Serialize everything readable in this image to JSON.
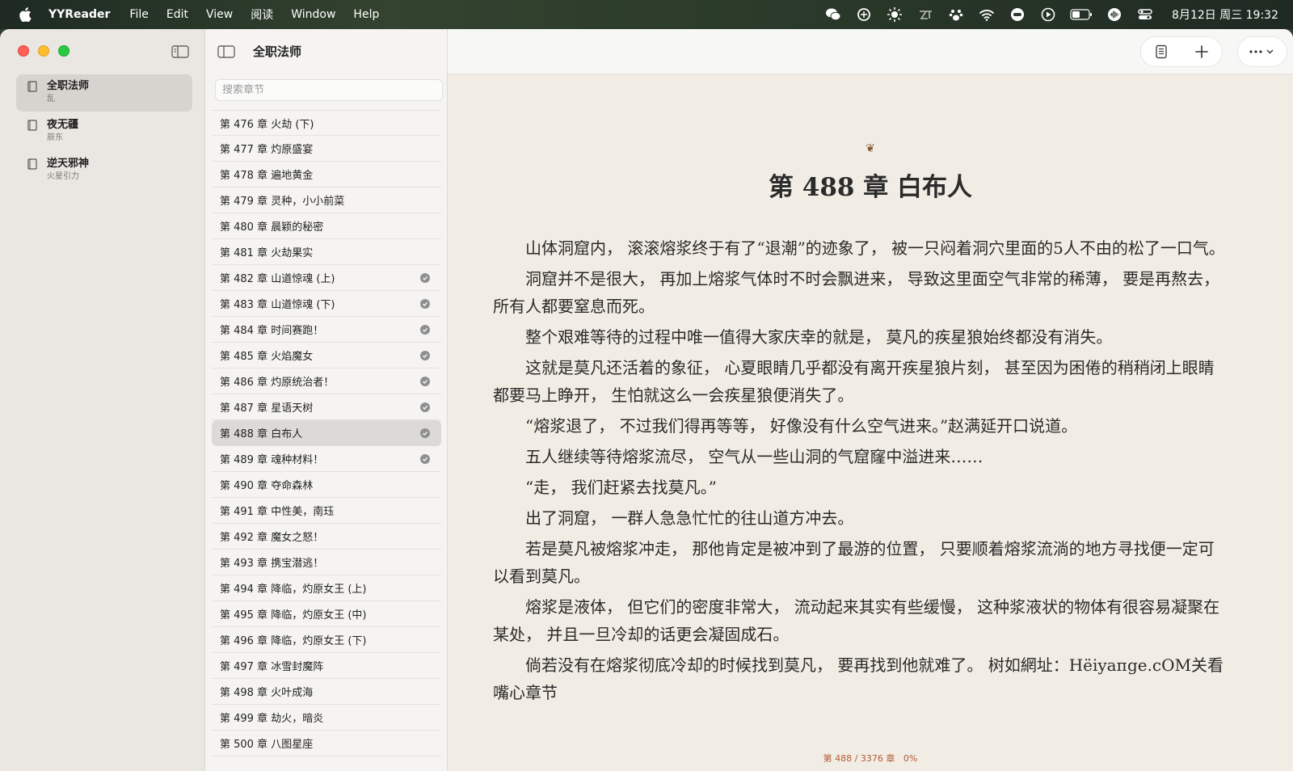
{
  "menubar": {
    "app_name": "YYReader",
    "items": [
      "File",
      "Edit",
      "View",
      "阅读",
      "Window",
      "Help"
    ],
    "clock": "8月12日 周三 19:32",
    "tray_icons": [
      "wechat-icon",
      "openai-icon",
      "brightness-icon",
      "zt-icon",
      "paw-icon",
      "wifi-icon",
      "vpn-icon",
      "play-icon",
      "battery-icon",
      "siri-icon",
      "control-center-icon"
    ]
  },
  "sidebar": {
    "books": [
      {
        "title": "全职法师",
        "author": "乱",
        "active": true
      },
      {
        "title": "夜无疆",
        "author": "辰东",
        "active": false
      },
      {
        "title": "逆天邪神",
        "author": "火星引力",
        "active": false
      }
    ]
  },
  "chapter_list": {
    "book_title": "全职法师",
    "search_placeholder": "搜索章节",
    "items": [
      {
        "label": "第 476 章 火劫 (下)",
        "read": false,
        "active": false
      },
      {
        "label": "第 477 章 灼原盛宴",
        "read": false,
        "active": false
      },
      {
        "label": "第 478 章 遍地黄金",
        "read": false,
        "active": false
      },
      {
        "label": "第 479 章 灵种，小小前菜",
        "read": false,
        "active": false
      },
      {
        "label": "第 480 章 晨颖的秘密",
        "read": false,
        "active": false
      },
      {
        "label": "第 481 章 火劫果实",
        "read": false,
        "active": false
      },
      {
        "label": "第 482 章 山道惊魂 (上)",
        "read": true,
        "active": false
      },
      {
        "label": "第 483 章 山道惊魂 (下)",
        "read": true,
        "active": false
      },
      {
        "label": "第 484 章 时间赛跑！",
        "read": true,
        "active": false
      },
      {
        "label": "第 485 章 火焰魔女",
        "read": true,
        "active": false
      },
      {
        "label": "第 486 章 灼原统治者！",
        "read": true,
        "active": false
      },
      {
        "label": "第 487 章 星语天树",
        "read": true,
        "active": false
      },
      {
        "label": "第 488 章 白布人",
        "read": true,
        "active": true
      },
      {
        "label": "第 489 章 魂种材料！",
        "read": true,
        "active": false
      },
      {
        "label": "第 490 章 夺命森林",
        "read": false,
        "active": false
      },
      {
        "label": "第 491 章 中性美，南珏",
        "read": false,
        "active": false
      },
      {
        "label": "第 492 章 魔女之怒！",
        "read": false,
        "active": false
      },
      {
        "label": "第 493 章 携宝潜逃！",
        "read": false,
        "active": false
      },
      {
        "label": "第 494 章 降临，灼原女王 (上)",
        "read": false,
        "active": false
      },
      {
        "label": "第 495 章 降临，灼原女王 (中)",
        "read": false,
        "active": false
      },
      {
        "label": "第 496 章 降临，灼原女王 (下)",
        "read": false,
        "active": false
      },
      {
        "label": "第 497 章 冰雪封魔阵",
        "read": false,
        "active": false
      },
      {
        "label": "第 498 章 火叶成海",
        "read": false,
        "active": false
      },
      {
        "label": "第 499 章 劫火，暗炎",
        "read": false,
        "active": false
      },
      {
        "label": "第 500 章 八图星座",
        "read": false,
        "active": false
      }
    ]
  },
  "reader": {
    "ornament": "❦",
    "chapter_title": "第 488 章 白布人",
    "paragraphs": [
      "山体洞窟内， 滚滚熔浆终于有了“退潮”的迹象了， 被一只闷着洞穴里面的5人不由的松了一口气。",
      "洞窟并不是很大， 再加上熔浆气体时不时会飘进来， 导致这里面空气非常的稀薄， 要是再熬去， 所有人都要窒息而死。",
      "整个艰难等待的过程中唯一值得大家庆幸的就是， 莫凡的疾星狼始终都没有消失。",
      "这就是莫凡还活着的象征， 心夏眼睛几乎都没有离开疾星狼片刻， 甚至因为困倦的稍稍闭上眼睛都要马上睁开， 生怕就这么一会疾星狼便消失了。",
      "“熔浆退了， 不过我们得再等等， 好像没有什么空气进来。”赵满延开口说道。",
      "五人继续等待熔浆流尽， 空气从一些山洞的气窟窿中溢进来……",
      "“走， 我们赶紧去找莫凡。”",
      "出了洞窟， 一群人急急忙忙的往山道方冲去。",
      "若是莫凡被熔浆冲走， 那他肯定是被冲到了最游的位置， 只要顺着熔浆流淌的地方寻找便一定可以看到莫凡。",
      "熔浆是液体， 但它们的密度非常大， 流动起来其实有些缓慢， 这种浆液状的物体有很容易凝聚在某处， 并且一旦冷却的话更会凝固成石。",
      "倘若没有在熔浆彻底冷却的时候找到莫凡， 要再找到他就难了。 树如網址：Hëiyaпge.cOM关看嘴心章节"
    ],
    "progress_text": "第 488 / 3376 章",
    "progress_percent": "0%"
  }
}
